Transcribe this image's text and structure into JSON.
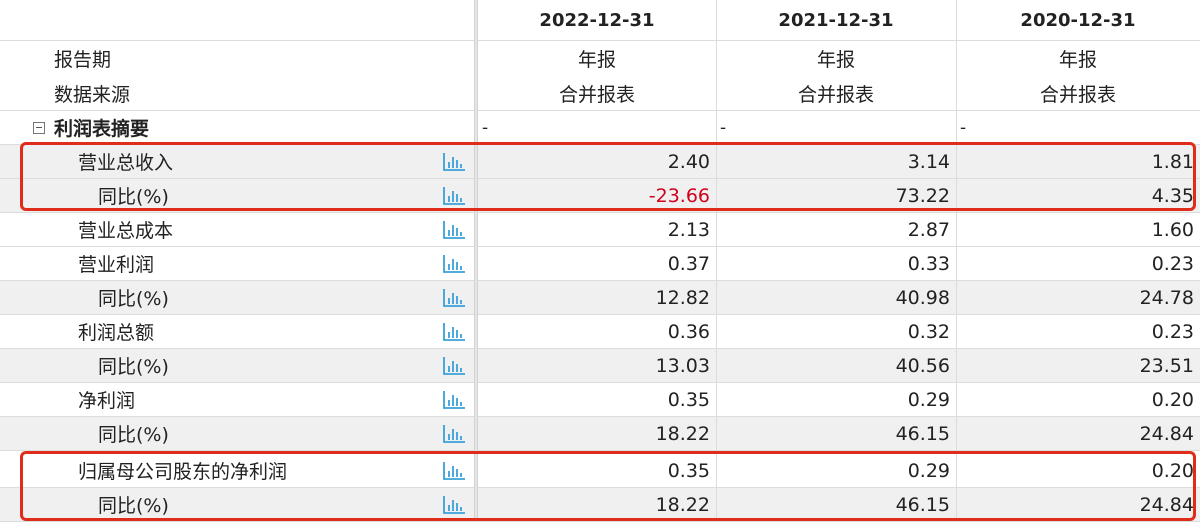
{
  "columns": [
    "2022-12-31",
    "2021-12-31",
    "2020-12-31"
  ],
  "report_period": {
    "label": "报告期",
    "values": [
      "年报",
      "年报",
      "年报"
    ]
  },
  "data_source": {
    "label": "数据来源",
    "values": [
      "合并报表",
      "合并报表",
      "合并报表"
    ]
  },
  "section": {
    "label": "利润表摘要",
    "toggle": "collapse",
    "values": [
      "-",
      "-",
      "-"
    ]
  },
  "rows": [
    {
      "label": "营业总收入",
      "values": [
        "2.40",
        "3.14",
        "1.81"
      ]
    },
    {
      "label": "同比(%)",
      "values": [
        "-23.66",
        "73.22",
        "4.35"
      ]
    },
    {
      "label": "营业总成本",
      "values": [
        "2.13",
        "2.87",
        "1.60"
      ]
    },
    {
      "label": "营业利润",
      "values": [
        "0.37",
        "0.33",
        "0.23"
      ]
    },
    {
      "label": "同比(%)",
      "values": [
        "12.82",
        "40.98",
        "24.78"
      ]
    },
    {
      "label": "利润总额",
      "values": [
        "0.36",
        "0.32",
        "0.23"
      ]
    },
    {
      "label": "同比(%)",
      "values": [
        "13.03",
        "40.56",
        "23.51"
      ]
    },
    {
      "label": "净利润",
      "values": [
        "0.35",
        "0.29",
        "0.20"
      ]
    },
    {
      "label": "同比(%)",
      "values": [
        "18.22",
        "46.15",
        "24.84"
      ]
    },
    {
      "label": "归属母公司股东的净利润",
      "values": [
        "0.35",
        "0.29",
        "0.20"
      ]
    },
    {
      "label": "同比(%)",
      "values": [
        "18.22",
        "46.15",
        "24.84"
      ]
    }
  ],
  "icons": {
    "chart": "bar-chart-icon"
  },
  "colors": {
    "negative": "#d0021b",
    "highlight": "#e02d1b",
    "icon": "#3aa0d8",
    "row_stripe": "#f0f0f0"
  }
}
